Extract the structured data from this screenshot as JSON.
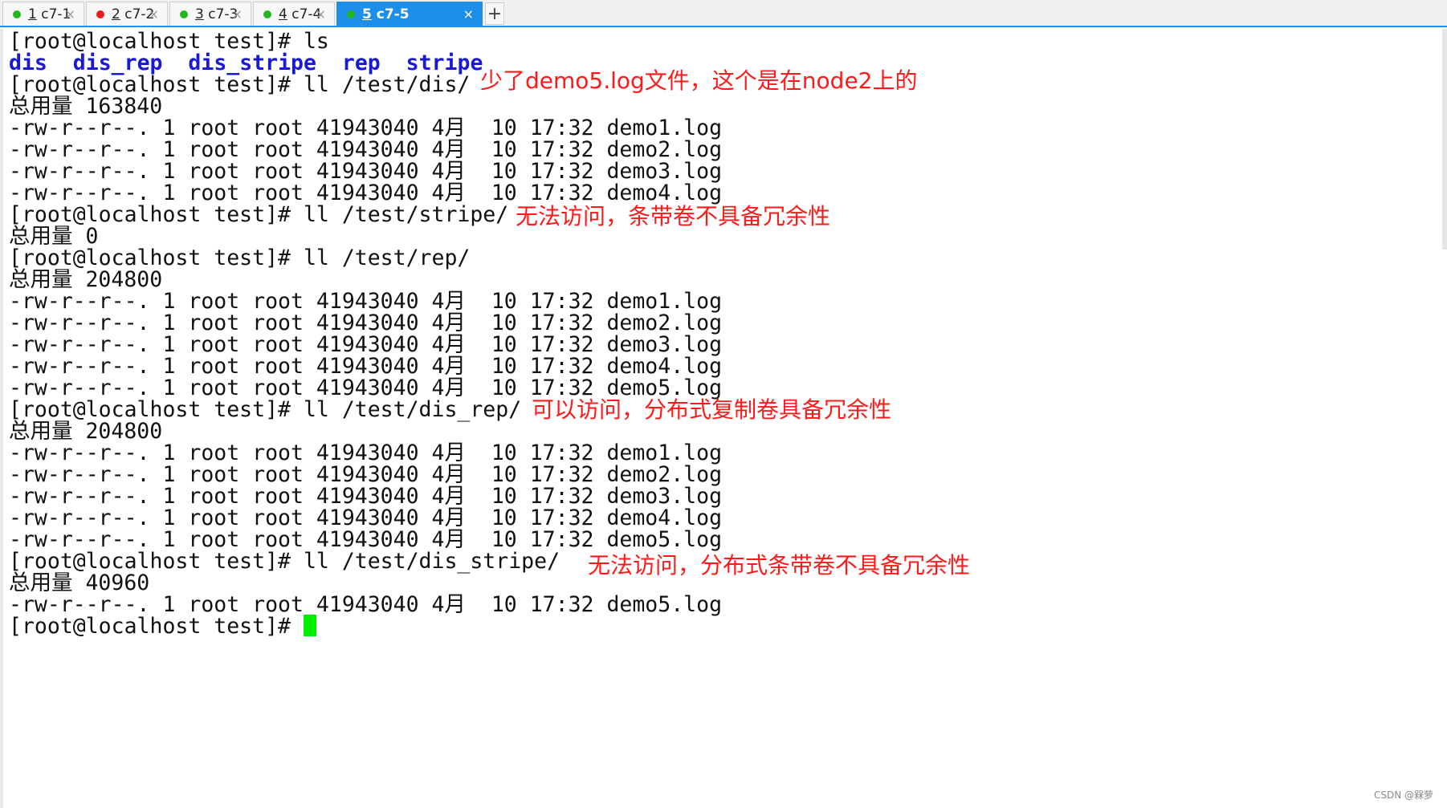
{
  "tabs": [
    {
      "num": "1",
      "name": " c7-1",
      "status_color": "#22b522",
      "active": false
    },
    {
      "num": "2",
      "name": " c7-2",
      "status_color": "#e81c1c",
      "active": false
    },
    {
      "num": "3",
      "name": " c7-3",
      "status_color": "#22b522",
      "active": false
    },
    {
      "num": "4",
      "name": " c7-4",
      "status_color": "#22b522",
      "active": false
    },
    {
      "num": "5",
      "name": " c7-5",
      "status_color": "#22b522",
      "active": true
    }
  ],
  "tab_close_glyph": "×",
  "add_tab_glyph": "+",
  "terminal": {
    "lines": [
      "[root@localhost test]# ls",
      "",
      "[root@localhost test]# ll /test/dis/",
      "总用量 163840",
      "-rw-r--r--. 1 root root 41943040 4月  10 17:32 demo1.log",
      "-rw-r--r--. 1 root root 41943040 4月  10 17:32 demo2.log",
      "-rw-r--r--. 1 root root 41943040 4月  10 17:32 demo3.log",
      "-rw-r--r--. 1 root root 41943040 4月  10 17:32 demo4.log",
      "[root@localhost test]# ll /test/stripe/",
      "总用量 0",
      "[root@localhost test]# ll /test/rep/",
      "总用量 204800",
      "-rw-r--r--. 1 root root 41943040 4月  10 17:32 demo1.log",
      "-rw-r--r--. 1 root root 41943040 4月  10 17:32 demo2.log",
      "-rw-r--r--. 1 root root 41943040 4月  10 17:32 demo3.log",
      "-rw-r--r--. 1 root root 41943040 4月  10 17:32 demo4.log",
      "-rw-r--r--. 1 root root 41943040 4月  10 17:32 demo5.log",
      "[root@localhost test]# ll /test/dis_rep/",
      "总用量 204800",
      "-rw-r--r--. 1 root root 41943040 4月  10 17:32 demo1.log",
      "-rw-r--r--. 1 root root 41943040 4月  10 17:32 demo2.log",
      "-rw-r--r--. 1 root root 41943040 4月  10 17:32 demo3.log",
      "-rw-r--r--. 1 root root 41943040 4月  10 17:32 demo4.log",
      "-rw-r--r--. 1 root root 41943040 4月  10 17:32 demo5.log",
      "[root@localhost test]# ll /test/dis_stripe/",
      "总用量 40960",
      "-rw-r--r--. 1 root root 41943040 4月  10 17:32 demo5.log",
      "[root@localhost test]# "
    ],
    "ls_output": [
      "dis",
      "dis_rep",
      "dis_stripe",
      "rep",
      "stripe"
    ],
    "cursor_color": "#00ee00"
  },
  "annotations": {
    "dis": "少了demo5.log文件，这个是在node2上的",
    "stripe": "无法访问，条带卷不具备冗余性",
    "dis_rep": "可以访问，分布式复制卷具备冗余性",
    "dis_stripe": "无法访问，分布式条带卷不具备冗余性"
  },
  "annotation_color": "#ff1a1a",
  "watermark": "CSDN @槑萝"
}
